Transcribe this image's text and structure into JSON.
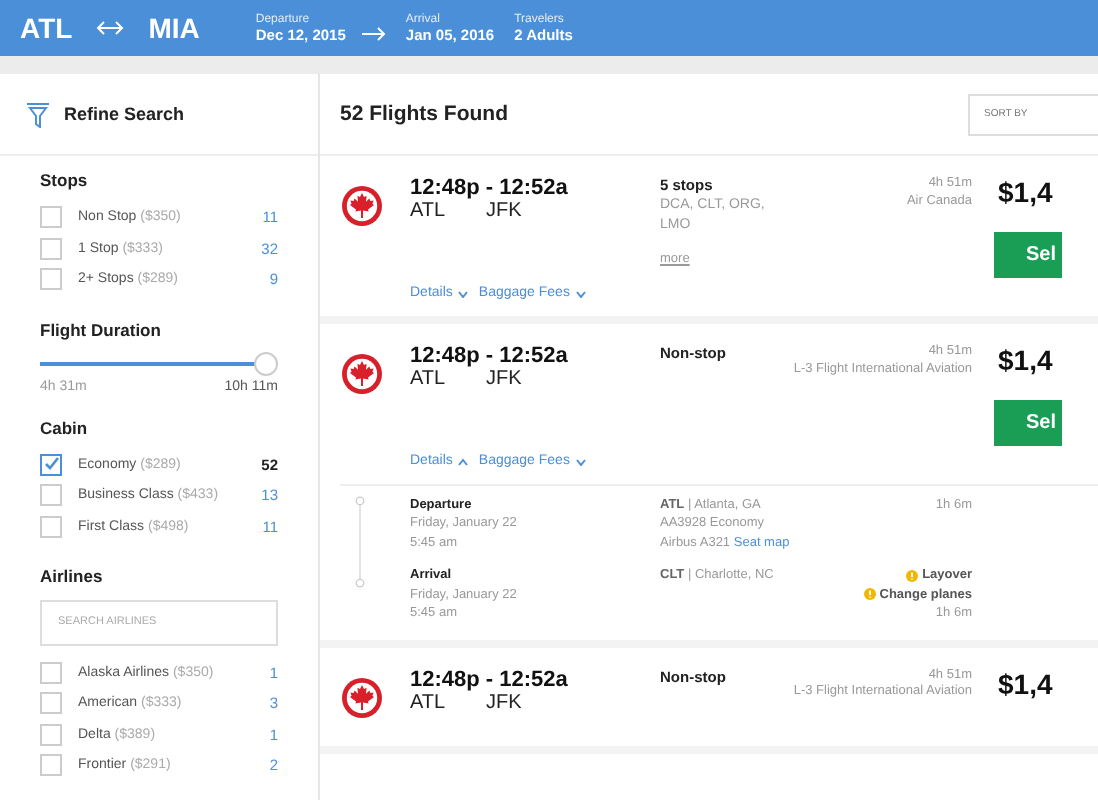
{
  "header": {
    "origin": "ATL",
    "destination": "MIA",
    "fields": [
      {
        "label": "Departure",
        "value": "Dec 12, 2015"
      },
      {
        "label": "Arrival",
        "value": "Jan 05, 2016"
      },
      {
        "label": "Travelers",
        "value": "2 Adults"
      }
    ]
  },
  "sidebar": {
    "title": "Refine Search",
    "sections": [
      {
        "kind": "checklist",
        "title": "Stops",
        "options": [
          {
            "label": "Non Stop",
            "price": "($350)",
            "count": "11",
            "checked": false
          },
          {
            "label": "1 Stop",
            "price": "($333)",
            "count": "32",
            "checked": false
          },
          {
            "label": "2+ Stops",
            "price": "($289)",
            "count": "9",
            "checked": false
          }
        ]
      },
      {
        "kind": "range",
        "title": "Flight Duration",
        "level": 1,
        "min": "4h 31m",
        "max": "10h 11m"
      },
      {
        "kind": "checklist",
        "title": "Cabin",
        "options": [
          {
            "label": "Economy",
            "price": "($289)",
            "count": "52",
            "checked": true
          },
          {
            "label": "Business Class",
            "price": "($433)",
            "count": "13",
            "checked": false
          },
          {
            "label": "First Class",
            "price": "($498)",
            "count": "11",
            "checked": false
          }
        ]
      },
      {
        "kind": "checklist",
        "title": "Airlines",
        "placeholder": "SEARCH AIRLINES",
        "options": [
          {
            "label": "Alaska Airlines",
            "price": "($350)",
            "count": "1",
            "checked": false
          },
          {
            "label": "American",
            "price": "($333)",
            "count": "3",
            "checked": false
          },
          {
            "label": "Delta",
            "price": "($389)",
            "count": "1",
            "checked": false
          },
          {
            "label": "Frontier",
            "price": "($291)",
            "count": "2",
            "checked": false
          }
        ]
      }
    ]
  },
  "results": {
    "title": "52 Flights Found",
    "sort_placeholder": "SORT BY",
    "flights": [
      {
        "times": "12:48p - 12:52a",
        "from": "ATL",
        "to": "JFK",
        "stops": "5 stops",
        "stop_list": "DCA, CLT, ORG, LMO",
        "more": "more",
        "duration": "4h 51m",
        "airline": "Air Canada",
        "price": "$1,4",
        "button": "Sel",
        "details": "Details",
        "expanded": false,
        "baggage": "Baggage Fees"
      },
      {
        "times": "12:48p - 12:52a",
        "from": "ATL",
        "to": "JFK",
        "stops": "Non-stop",
        "duration": "4h 51m",
        "airline": "L-3 Flight International Aviation",
        "price": "$1,4",
        "button": "Sel",
        "details": "Details",
        "expanded": true,
        "baggage": "Baggage Fees",
        "segments": [
          {
            "label": "Departure",
            "date": "Friday, January 22",
            "time": "5:45 am",
            "code": "ATL",
            "city": "| Atlanta, GA",
            "flight": "AA3928",
            "cabin": "Economy",
            "aircraft": "Airbus A321",
            "seat_map": "Seat map",
            "duration": "1h 6m"
          },
          {
            "label": "Arrival",
            "date": "Friday, January 22",
            "time": "5:45 am",
            "code": "CLT",
            "city": "| Charlotte, NC",
            "notes": [
              "Layover",
              "Change planes"
            ],
            "duration": "1h 6m"
          }
        ]
      },
      {
        "times": "12:48p - 12:52a",
        "from": "ATL",
        "to": "JFK",
        "stops": "Non-stop",
        "duration": "4h 51m",
        "airline": "L-3 Flight International Aviation",
        "price": "$1,4"
      }
    ]
  }
}
